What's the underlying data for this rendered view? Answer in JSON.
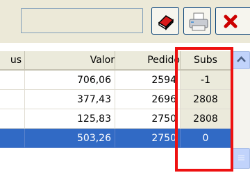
{
  "toolbar": {
    "buttons": [
      {
        "icon": "eraser-icon"
      },
      {
        "icon": "printer-icon"
      },
      {
        "icon": "close-icon"
      }
    ]
  },
  "grid": {
    "columns": {
      "partial": "us",
      "valor": "Valor",
      "pedido": "Pedido",
      "subs": "Subs"
    },
    "rows": [
      {
        "valor": "706,06",
        "pedido": "2594",
        "subs": "-1"
      },
      {
        "valor": "377,43",
        "pedido": "2696",
        "subs": "2808"
      },
      {
        "valor": "125,83",
        "pedido": "2750",
        "subs": "2808"
      },
      {
        "valor": "503,26",
        "pedido": "2750",
        "subs": "0",
        "selected": true
      }
    ]
  },
  "colors": {
    "selection": "#316ac5",
    "highlight_border": "#ee1111",
    "toolbar_bg": "#ece9d8"
  }
}
